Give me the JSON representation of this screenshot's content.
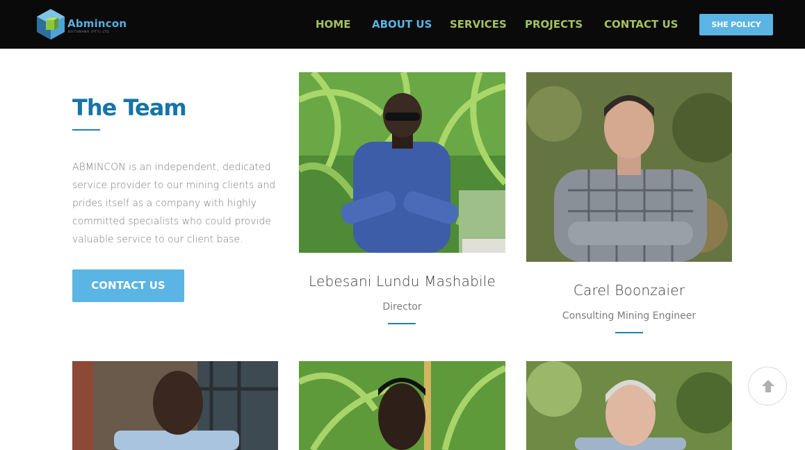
{
  "brand": {
    "name": "Abmincon",
    "subtitle": "BOTSWANA (PTY) LTD",
    "colors": {
      "header_bg": "#0a0a0a",
      "nav": "#a6c25a",
      "accent": "#5ab4e4",
      "title": "#1474a8"
    }
  },
  "nav": {
    "items": [
      {
        "label": "HOME",
        "active": false
      },
      {
        "label": "ABOUT US",
        "active": true
      },
      {
        "label": "SERVICES",
        "active": false
      },
      {
        "label": "PROJECTS",
        "active": false
      },
      {
        "label": "CONTACT US",
        "active": false
      }
    ],
    "cta_label": "SHE POLICY"
  },
  "intro": {
    "title": "The Team",
    "body": "ABMINCON is an independent, dedicated service provider to our mining clients and prides itself as a company with highly committed specialists who could provide valuable service to our client base.",
    "button_label": "CONTACT US"
  },
  "team": [
    {
      "name": "Lebesani Lundu Mashabile",
      "role": "Director"
    },
    {
      "name": "Carel Boonzaier",
      "role": "Consulting Mining Engineer"
    }
  ],
  "icons": {
    "scroll_top": "arrow-up-icon",
    "logo": "cube-logo-icon"
  }
}
